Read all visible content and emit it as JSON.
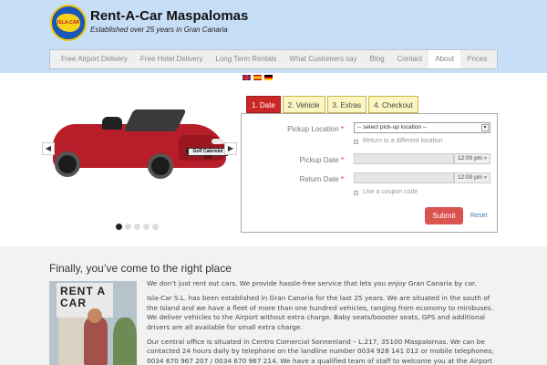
{
  "header": {
    "brand": "Rent-A-Car Maspalomas",
    "tagline": "Established over 25 years in Gran Canaria",
    "logo_text": "ISLA-CAR",
    "background_color": "#c7def7"
  },
  "nav": {
    "items": [
      {
        "label": "Free Airport Delivery"
      },
      {
        "label": "Free Hotel Delivery"
      },
      {
        "label": "Long Term Rentals"
      },
      {
        "label": "What Customers say"
      },
      {
        "label": "Blog"
      },
      {
        "label": "Contact"
      },
      {
        "label": "About",
        "active": true
      },
      {
        "label": "Prices"
      }
    ]
  },
  "slider": {
    "plate_text": "Golf Cabriolet GTI",
    "dots": 5,
    "active_dot": 1,
    "prev_icon": "chevron-left-icon",
    "next_icon": "chevron-right-icon"
  },
  "languages": [
    "English",
    "Español",
    "Deutsch"
  ],
  "booking": {
    "tabs": [
      {
        "label": "1. Date",
        "active": true
      },
      {
        "label": "2. Vehicle"
      },
      {
        "label": "3. Extras"
      },
      {
        "label": "4. Checkout"
      }
    ],
    "pickup_location_label": "Pickup Location",
    "pickup_location_value": "-- select pick-up location --",
    "return_different_label": "Return to a different location",
    "pickup_date_label": "Pickup Date",
    "pickup_time": "12:00 pm",
    "return_date_label": "Return Date",
    "return_time": "12:00 pm",
    "coupon_label": "Use a coupon code",
    "required_mark": "*",
    "submit_label": "Submit",
    "reset_label": "Reset",
    "accent_color": "#d9534f"
  },
  "content": {
    "heading": "Finally, you’ve come to the right place",
    "photo_sign": "RENT A CAR",
    "p1_before": "We don’t just rent out cars. We provide hassle-free service that lets you ",
    "p1_em": "enjoy",
    "p1_after": " Gran Canaria by car.",
    "p2": "Isla-Car S.L. has been established in Gran Canaria for the last 25 years. We are situated in the south of the Island and we have a fleet of more than one hundred vehicles, ranging from economy to minibuses. We deliver vehicles to the Airport without extra charge. Baby seats/booster seats, GPS and additional drivers are all available for small extra charge.",
    "p3": "Our central office is situated in Centro Comercial Sonnenland – L.217, 35100 Maspalomas. We can be contacted 24 hours daily by telephone on the landline number 0034 928 141 012 or mobile telephones; 0034 670 967 207 / 0034 670 967 214. We have a qualified team of staff to welcome you at the Airport and to assure complete satisfaction with your car hire."
  }
}
